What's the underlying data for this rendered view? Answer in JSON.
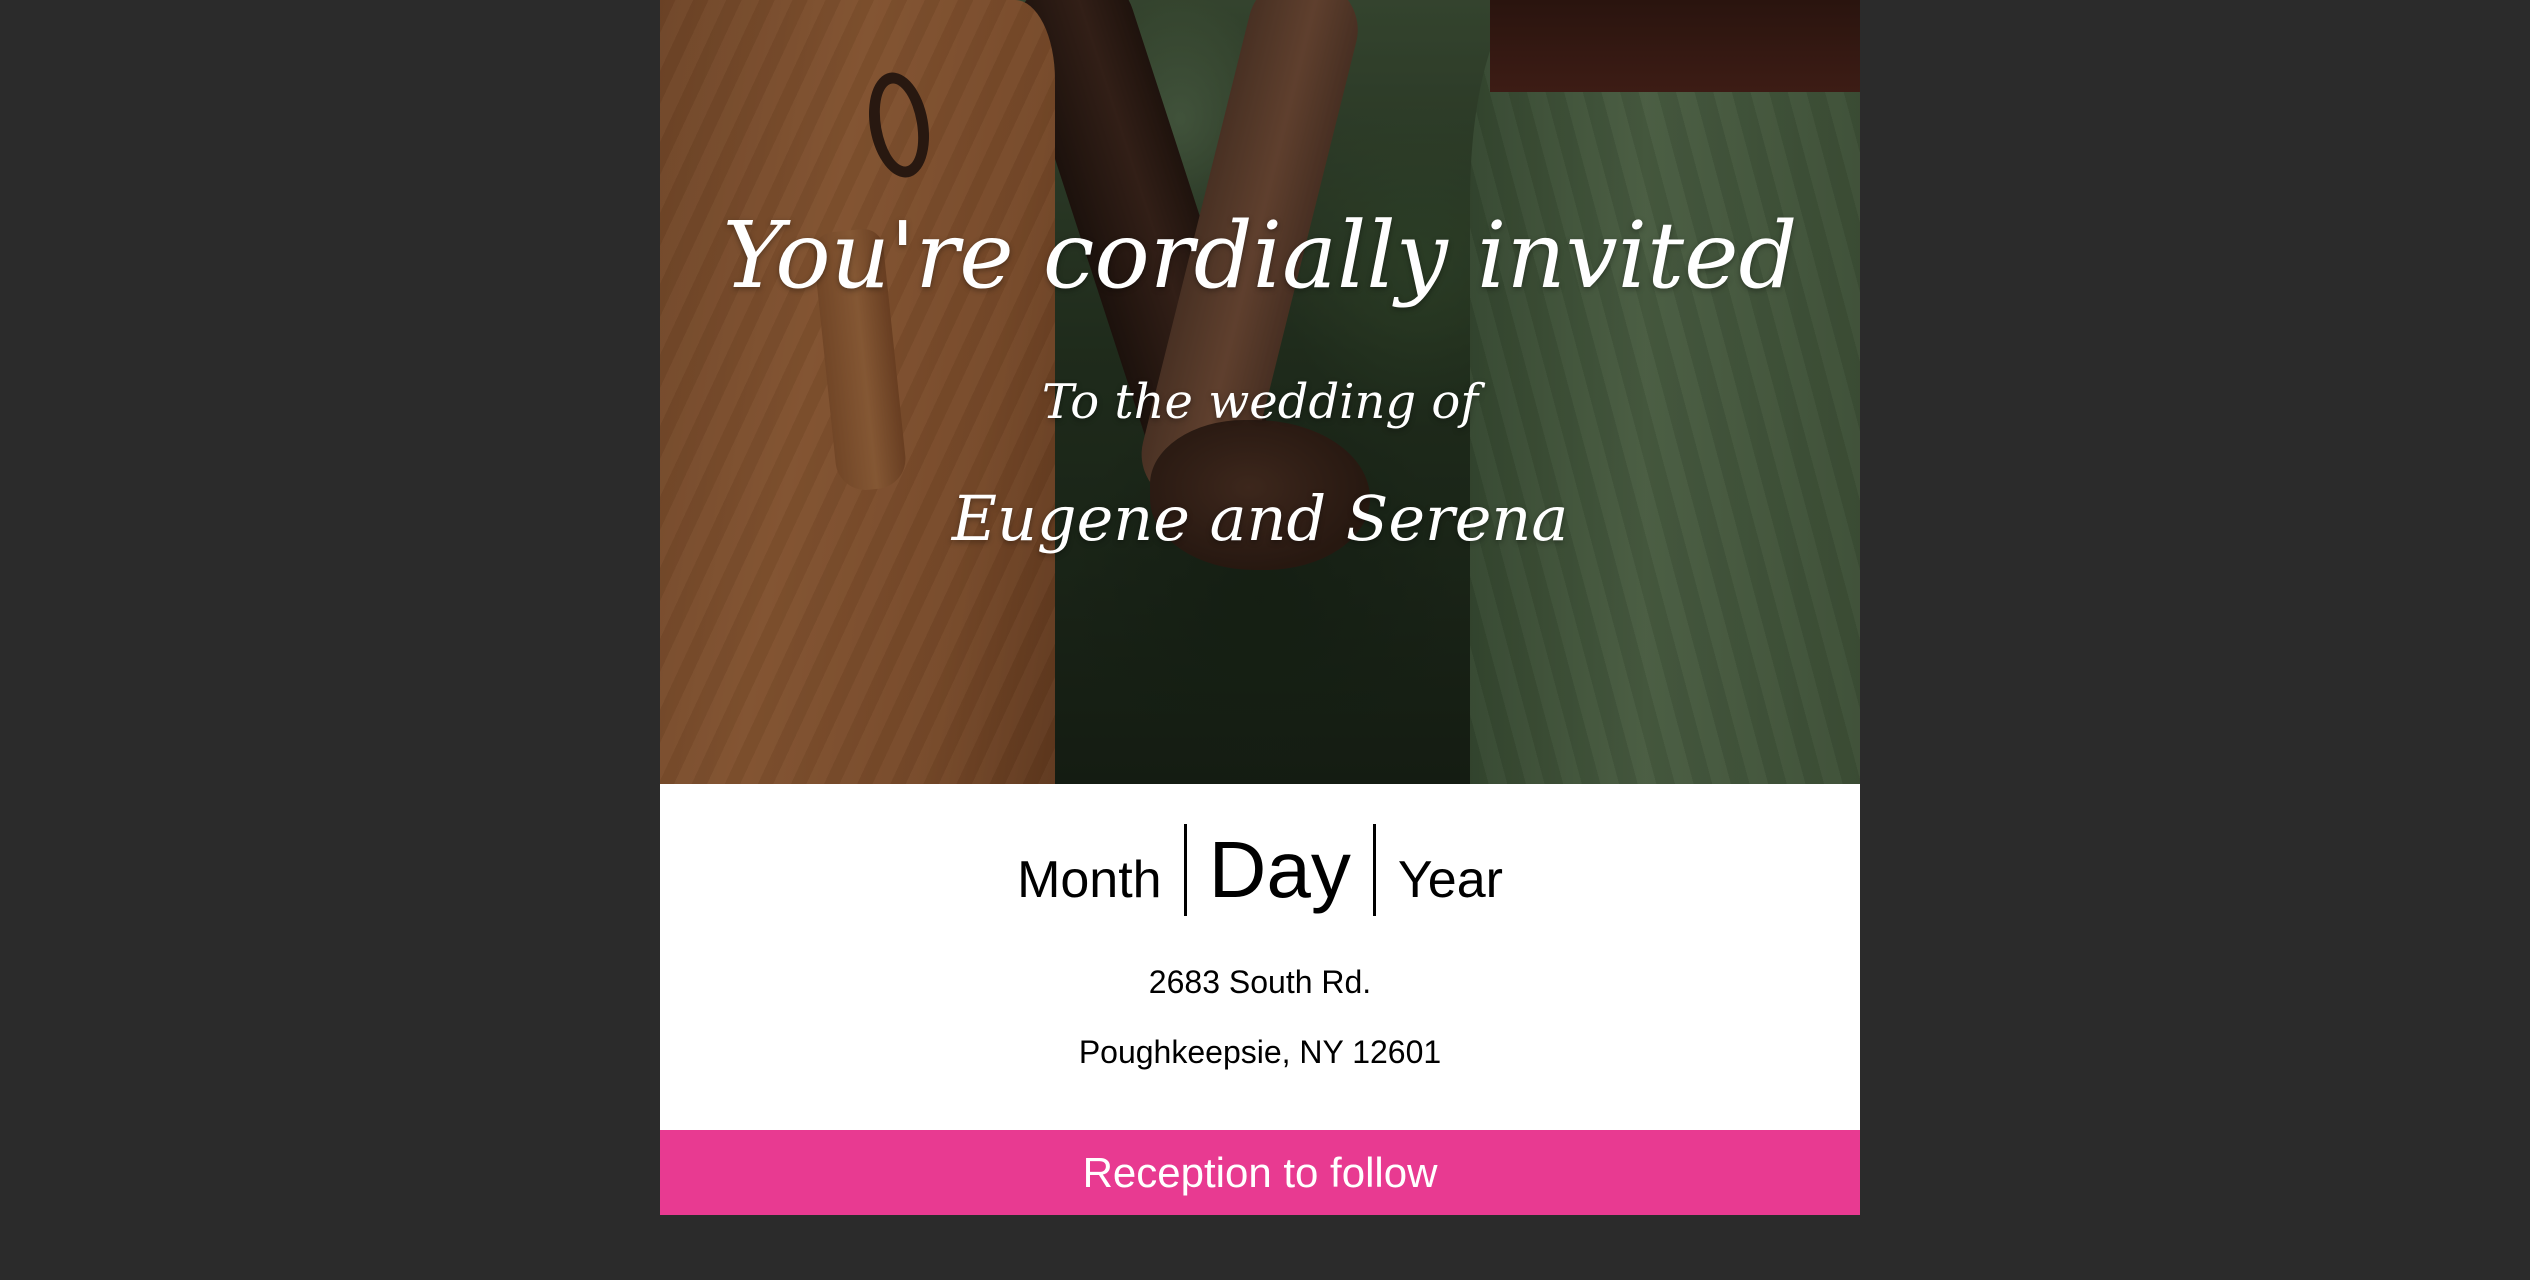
{
  "invitation": {
    "headline": "You're cordially invited",
    "subline": "To the wedding of",
    "couple": "Eugene and Serena"
  },
  "date": {
    "month": "Month",
    "day": "Day",
    "year": "Year"
  },
  "address": {
    "line1": "2683 South Rd.",
    "line2": "Poughkeepsie, NY 12601"
  },
  "footer": {
    "text": "Reception to follow",
    "color": "#e83a91"
  },
  "colors": {
    "page_background": "#2b2b2b",
    "card_background": "#ffffff"
  }
}
